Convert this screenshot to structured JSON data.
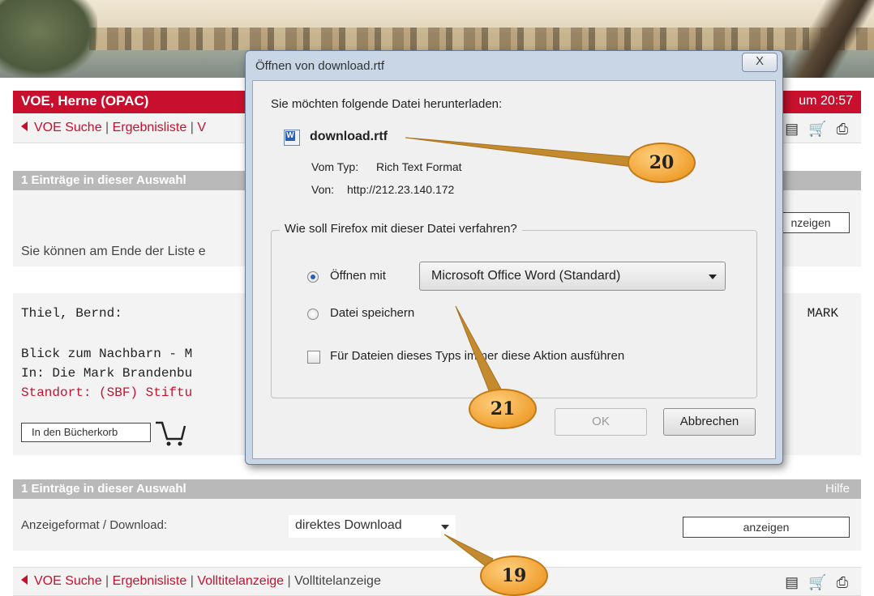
{
  "app": {
    "title": "VOE, Herne (OPAC)",
    "header_right": "um 20:57"
  },
  "nav": {
    "items": [
      "VOE Suche",
      "Ergebnisliste",
      "Volltitelanzeige"
    ],
    "current": "Volltitelanzeige",
    "top_partial": "V",
    "icons": [
      "list-icon",
      "cart-icon",
      "print-icon"
    ]
  },
  "selection": {
    "header": "1 Einträge in dieser Auswahl",
    "help": "Hilfe",
    "hint": "Sie können am Ende der Liste e",
    "show_button": "anzeigen",
    "show_button_partial": "nzeigen"
  },
  "record": {
    "author": "Thiel, Bernd:",
    "title": "Blick zum Nachbarn - M",
    "in": "In: Die Mark Brandenbu",
    "location": "Standort: (SBF) Stiftu",
    "right_text": "MARK",
    "basket_button": "In den Bücherkorb"
  },
  "download": {
    "label": "Anzeigeformat / Download:",
    "selected": "direktes Download",
    "button": "anzeigen"
  },
  "dialog": {
    "title": "Öffnen von download.rtf",
    "close": "X",
    "question": "Sie möchten folgende Datei herunterladen:",
    "filename": "download.rtf",
    "type_label": "Vom Typ:",
    "type_value": "Rich Text Format",
    "from_label": "Von:",
    "from_value": "http://212.23.140.172",
    "group_label": "Wie soll Firefox mit dieser Datei verfahren?",
    "open_with_label": "Öffnen mit",
    "open_with_app": "Microsoft Office Word (Standard)",
    "save_label": "Datei speichern",
    "always_label": "Für Dateien dieses Typs immer diese Aktion ausführen",
    "ok": "OK",
    "cancel": "Abbrechen"
  },
  "callouts": [
    "20",
    "21",
    "19"
  ]
}
